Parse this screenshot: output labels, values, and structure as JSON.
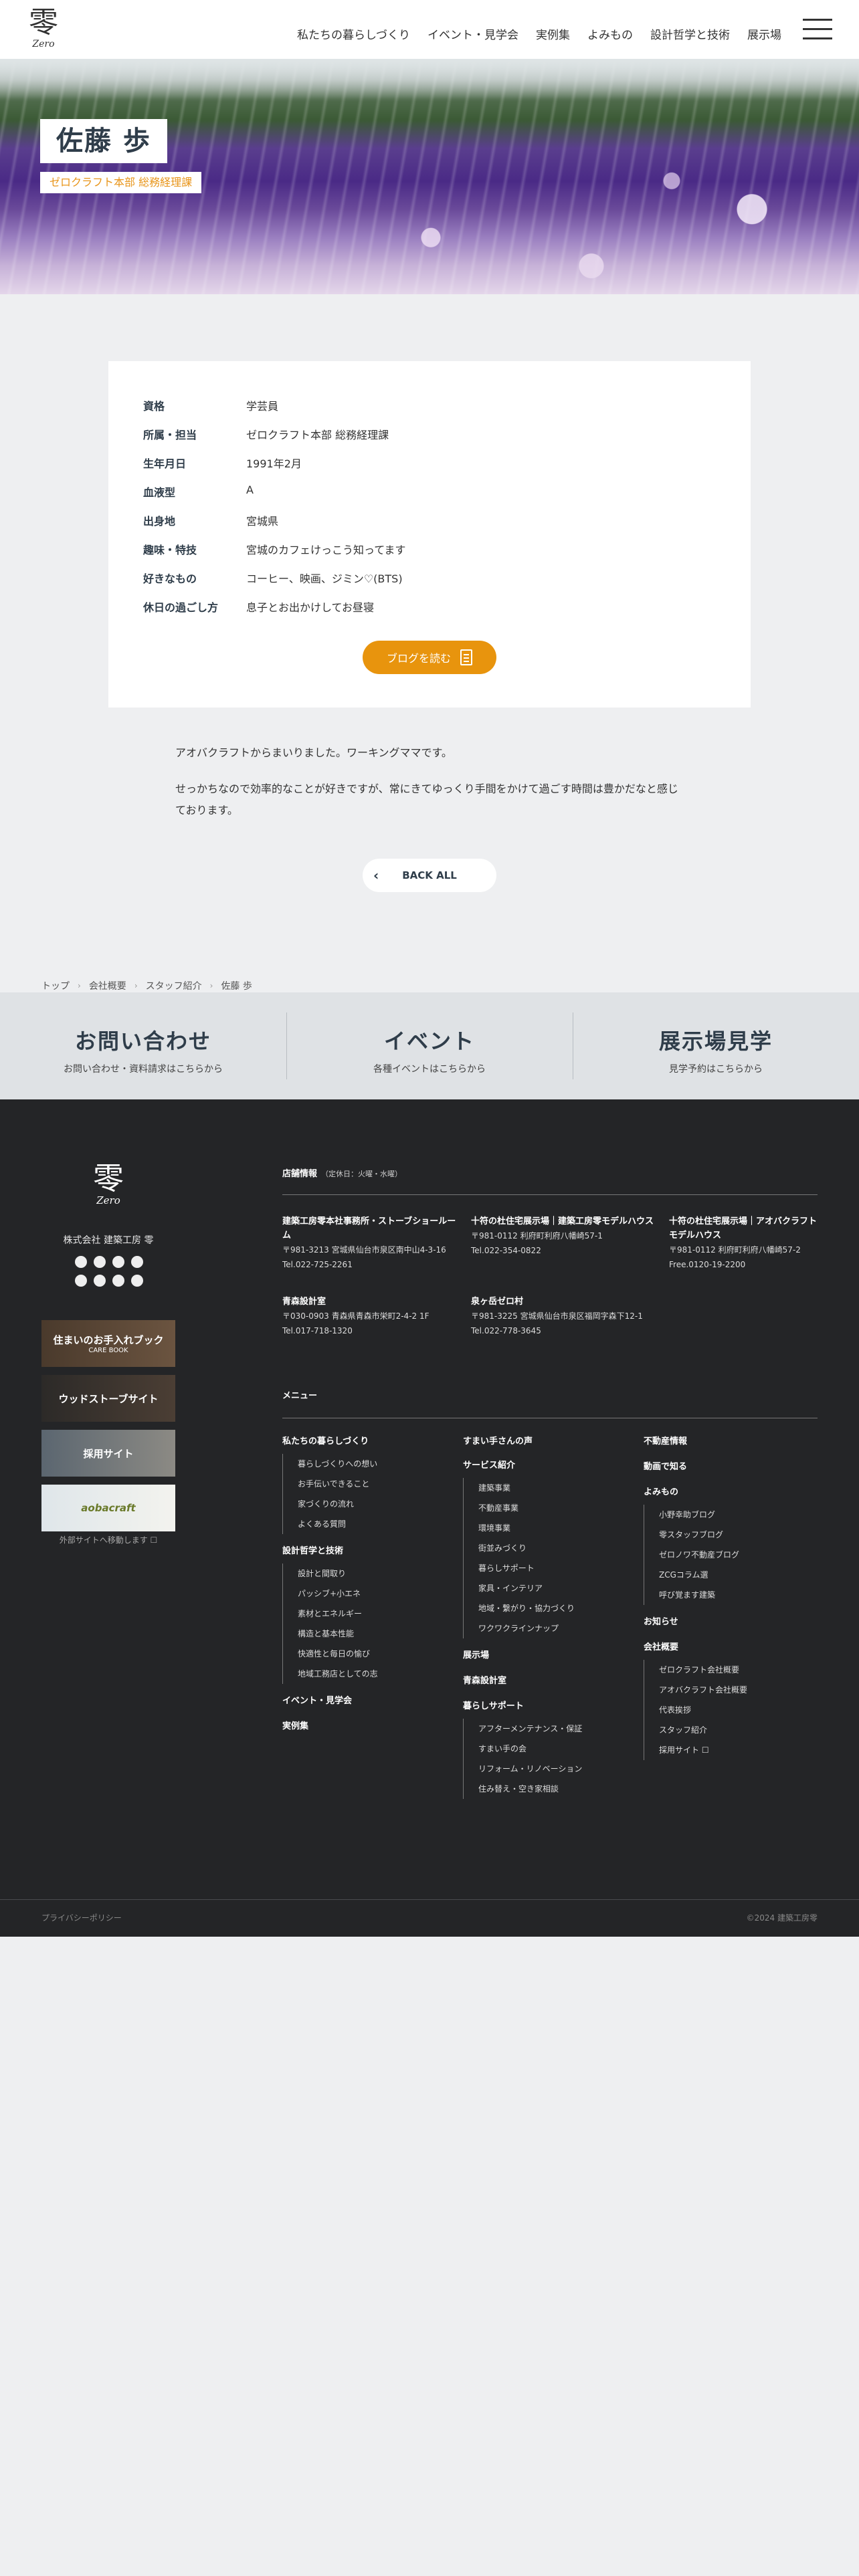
{
  "header": {
    "logo_kanji": "零",
    "logo_en": "Zero",
    "nav": [
      "私たちの暮らしづくり",
      "イベント・見学会",
      "実例集",
      "よみもの",
      "設計哲学と技術",
      "展示場"
    ]
  },
  "hero": {
    "name": "佐藤 歩",
    "dept": "ゼロクラフト本部 総務経理課"
  },
  "profile": [
    {
      "label": "資格",
      "value": "学芸員"
    },
    {
      "label": "所属・担当",
      "value": "ゼロクラフト本部 総務経理課"
    },
    {
      "label": "生年月日",
      "value": "1991年2月"
    },
    {
      "label": "血液型",
      "value": "A"
    },
    {
      "label": "出身地",
      "value": "宮城県"
    },
    {
      "label": "趣味・特技",
      "value": "宮城のカフェけっこう知ってます"
    },
    {
      "label": "好きなもの",
      "value": "コーヒー、映画、ジミン♡(BTS)"
    },
    {
      "label": "休日の過ごし方",
      "value": "息子とお出かけしてお昼寝"
    }
  ],
  "blog_button": "ブログを読む",
  "bio": [
    "アオバクラフトからまいりました。ワーキングママです。",
    "せっかちなので効率的なことが好きですが、常にきてゆっくり手間をかけて過ごす時間は豊かだなと感じております。"
  ],
  "back_button": "BACK ALL",
  "breadcrumb": [
    "トップ",
    "会社概要",
    "スタッフ紹介",
    "佐藤 歩"
  ],
  "cta": [
    {
      "title": "お問い合わせ",
      "sub": "お問い合わせ・資料請求はこちらから"
    },
    {
      "title": "イベント",
      "sub": "各種イベントはこちらから"
    },
    {
      "title": "展示場見学",
      "sub": "見学予約はこちらから"
    }
  ],
  "footer": {
    "logo_kanji": "零",
    "logo_en": "Zero",
    "company": "株式会社 建築工房 零",
    "banners": [
      {
        "title": "住まいのお手入れブック",
        "sub": "CARE BOOK"
      },
      {
        "title": "ウッドストーブサイト",
        "sub": ""
      },
      {
        "title": "採用サイト",
        "sub": ""
      },
      {
        "title": "aobacraft",
        "sub": ""
      }
    ],
    "banner_note": "外部サイトへ移動します ☐",
    "shops_title": "店舗情報",
    "shops_note": "（定休日：火曜・水曜）",
    "shops": [
      {
        "name": "建築工房零本社事務所・ストーブショールーム",
        "addr": "〒981-3213 宮城県仙台市泉区南中山4-3-16",
        "tel": "Tel.022-725-2261"
      },
      {
        "name": "十符の杜住宅展示場｜建築工房零モデルハウス",
        "addr": "〒981-0112 利府町利府八幡崎57-1",
        "tel": "Tel.022-354-0822"
      },
      {
        "name": "十符の杜住宅展示場｜アオバクラフトモデルハウス",
        "addr": "〒981-0112 利府町利府八幡崎57-2",
        "tel": "Free.0120-19-2200"
      },
      {
        "name": "青森設計室",
        "addr": "〒030-0903 青森県青森市栄町2-4-2 1F",
        "tel": "Tel.017-718-1320"
      },
      {
        "name": "泉ヶ岳ゼロ村",
        "addr": "〒981-3225 宮城県仙台市泉区福岡字森下12-1",
        "tel": "Tel.022-778-3645"
      }
    ],
    "menu_title": "メニュー",
    "menu_col1": [
      {
        "head": "私たちの暮らしづくり",
        "items": [
          "暮らしづくりへの想い",
          "お手伝いできること",
          "家づくりの流れ",
          "よくある質問"
        ]
      },
      {
        "head": "設計哲学と技術",
        "items": [
          "設計と間取り",
          "パッシブ+小エネ",
          "素材とエネルギー",
          "構造と基本性能",
          "快適性と毎日の愉び",
          "地域工務店としての志"
        ]
      },
      {
        "head": "イベント・見学会",
        "items": []
      },
      {
        "head": "実例集",
        "items": []
      }
    ],
    "menu_col2": [
      {
        "head": "すまい手さんの声",
        "items": []
      },
      {
        "head": "サービス紹介",
        "items": [
          "建築事業",
          "不動産事業",
          "環境事業",
          "街並みづくり",
          "暮らしサポート",
          "家具・インテリア",
          "地域・繋がり・協力づくり",
          "ワクワクラインナップ"
        ]
      },
      {
        "head": "展示場",
        "items": []
      },
      {
        "head": "青森設計室",
        "items": []
      },
      {
        "head": "暮らしサポート",
        "items": [
          "アフターメンテナンス・保証",
          "すまい手の会",
          "リフォーム・リノベーション",
          "住み替え・空き家相談"
        ]
      }
    ],
    "menu_col3": [
      {
        "head": "不動産情報",
        "items": []
      },
      {
        "head": "動画で知る",
        "items": []
      },
      {
        "head": "よみもの",
        "items": [
          "小野幸助ブログ",
          "零スタッフブログ",
          "ゼロノワ不動産ブログ",
          "ZCGコラム選",
          "呼び覚ます建築"
        ]
      },
      {
        "head": "お知らせ",
        "items": []
      },
      {
        "head": "会社概要",
        "items": [
          "ゼロクラフト会社概要",
          "アオバクラフト会社概要",
          "代表挨拶",
          "スタッフ紹介",
          "採用サイト ☐"
        ]
      }
    ],
    "privacy": "プライバシーポリシー",
    "copyright": "©2024 建築工房零"
  }
}
